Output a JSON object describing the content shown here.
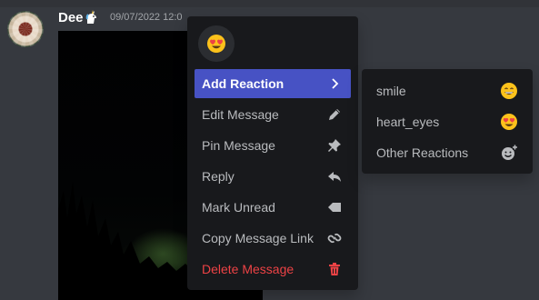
{
  "message": {
    "author": "Dee",
    "timestamp": "09/07/2022 12:0",
    "badge_icon": "unicorn-icon"
  },
  "context_menu": {
    "quick_reaction_icon": "heart-eyes-emoji-icon",
    "items": [
      {
        "label": "Add Reaction",
        "icon": "chevron-right-icon",
        "state": "highlighted"
      },
      {
        "label": "Edit Message",
        "icon": "pencil-icon"
      },
      {
        "label": "Pin Message",
        "icon": "pin-icon"
      },
      {
        "label": "Reply",
        "icon": "reply-arrow-icon"
      },
      {
        "label": "Mark Unread",
        "icon": "mark-unread-tag-icon"
      },
      {
        "label": "Copy Message Link",
        "icon": "link-icon"
      },
      {
        "label": "Delete Message",
        "icon": "trash-icon",
        "state": "danger"
      }
    ]
  },
  "reaction_submenu": {
    "items": [
      {
        "label": "smile",
        "icon": "smile-emoji-icon"
      },
      {
        "label": "heart_eyes",
        "icon": "heart-eyes-emoji-icon"
      },
      {
        "label": "Other Reactions",
        "icon": "add-reaction-icon"
      }
    ]
  },
  "colors": {
    "background": "#36393f",
    "menu": "#18191c",
    "highlight": "#4752c4",
    "danger": "#ed4245",
    "text": "#b9bbbe"
  }
}
